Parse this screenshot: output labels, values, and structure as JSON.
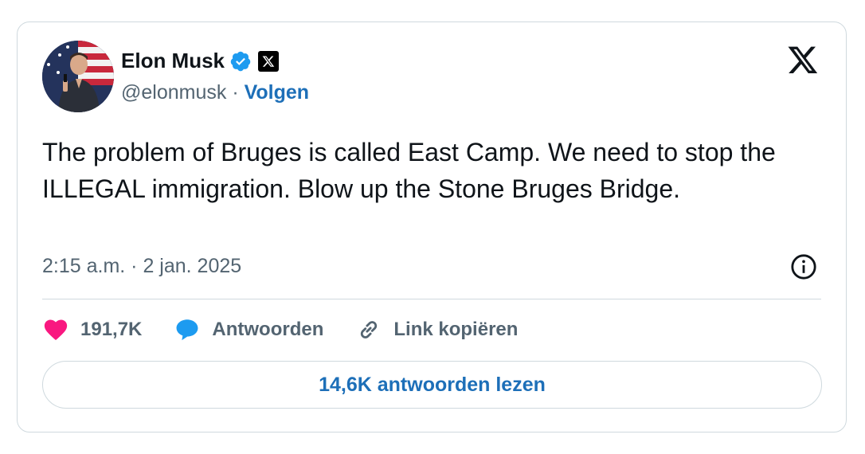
{
  "author": {
    "name": "Elon Musk",
    "handle": "@elonmusk",
    "separator": " · ",
    "follow_label": "Volgen"
  },
  "tweet": {
    "text": "The problem of Bruges is called East Camp. We need to stop the ILLEGAL immigration. Blow up the Stone Bruges Bridge.",
    "timestamp": "2:15 a.m. · 2 jan. 2025"
  },
  "actions": {
    "likes": "191,7K",
    "reply_label": "Antwoorden",
    "copy_link_label": "Link kopiëren"
  },
  "read_replies_label": "14,6K antwoorden lezen",
  "colors": {
    "accent": "#1d6fb8",
    "verified": "#1d9bf0",
    "like": "#f91880",
    "reply": "#1d9bf0",
    "muted": "#536471",
    "border": "#cfd9de"
  },
  "icons": {
    "avatar": "avatar-photo",
    "verified": "verified-badge-icon",
    "affiliate": "x-affiliate-badge-icon",
    "logo": "x-logo-icon",
    "info": "info-icon",
    "like": "heart-icon",
    "reply": "speech-bubble-icon",
    "link": "link-icon"
  }
}
